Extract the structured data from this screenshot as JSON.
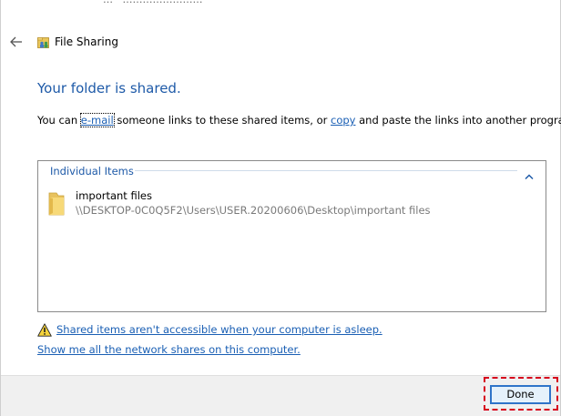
{
  "window": {
    "title": "File Sharing",
    "ghost_text": "…   ……………………"
  },
  "main": {
    "heading": "Your folder is shared.",
    "desc_prefix": "You can ",
    "email_link": "e-mail",
    "desc_middle": " someone links to these shared items, or ",
    "copy_link": "copy",
    "desc_suffix": " and paste the links into another program."
  },
  "items_group": {
    "header": "Individual Items",
    "items": [
      {
        "name": "important files",
        "path": "\\\\DESKTOP-0C0Q5F2\\Users\\USER.20200606\\Desktop\\important files"
      }
    ]
  },
  "links": {
    "sleep_warning": "Shared items aren't accessible when your computer is asleep.",
    "network_shares": "Show me all the network shares on this computer."
  },
  "footer": {
    "done_label": "Done"
  },
  "icons": {
    "back": "back-arrow-icon",
    "title": "file-sharing-icon",
    "collapse": "chevron-up-icon",
    "folder": "folder-icon",
    "warning": "warning-icon"
  },
  "colors": {
    "heading": "#1e5aa8",
    "link": "#1a5fb4",
    "path_text": "#7a7a7a",
    "footer_bg": "#f0f0f0",
    "highlight": "#d6001c",
    "button_border": "#2f74c9"
  }
}
